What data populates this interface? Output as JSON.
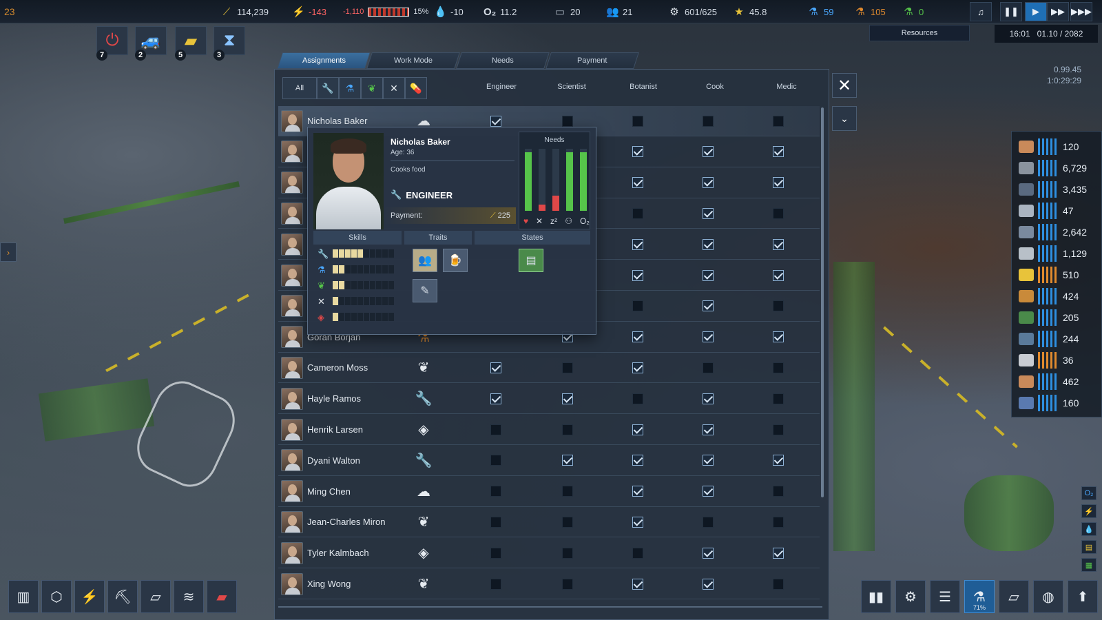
{
  "topbar": {
    "corner_number": "23",
    "money": "114,239",
    "energy": "-143",
    "energy_total": "-1,110",
    "battery_pct": "15%",
    "water": "-10",
    "oxygen": "11.2",
    "housing": "20",
    "colonists": "21",
    "storage": "601/625",
    "rating": "45.8",
    "research_blue": "59",
    "research_orange": "105",
    "research_green": "0"
  },
  "resources_button": "Resources",
  "date": {
    "time": "16:01",
    "date": "01.10 / 2082"
  },
  "version": {
    "v": "0.99.45",
    "clock": "1:0:29:29"
  },
  "status_buttons": [
    {
      "icon": "power-icon",
      "count": "7"
    },
    {
      "icon": "rover-icon",
      "count": "2"
    },
    {
      "icon": "gold-bars-icon",
      "count": "5"
    },
    {
      "icon": "hourglass-icon",
      "count": "3"
    }
  ],
  "tabs": [
    "Assignments",
    "Work Mode",
    "Needs",
    "Payment"
  ],
  "filter_all": "All",
  "columns": [
    "Engineer",
    "Scientist",
    "Botanist",
    "Cook",
    "Medic"
  ],
  "rows": [
    {
      "name": "Nicholas Baker",
      "role": "cook",
      "checks": [
        true,
        false,
        false,
        false,
        false
      ]
    },
    {
      "name": "",
      "role": "",
      "checks": [
        null,
        null,
        true,
        true,
        true
      ]
    },
    {
      "name": "",
      "role": "",
      "checks": [
        null,
        null,
        true,
        true,
        true
      ]
    },
    {
      "name": "",
      "role": "",
      "checks": [
        null,
        null,
        false,
        true,
        false
      ]
    },
    {
      "name": "",
      "role": "",
      "checks": [
        null,
        null,
        true,
        true,
        true
      ]
    },
    {
      "name": "",
      "role": "",
      "checks": [
        null,
        null,
        true,
        true,
        true
      ]
    },
    {
      "name": "",
      "role": "",
      "checks": [
        null,
        null,
        false,
        true,
        false
      ]
    },
    {
      "name": "Goran Borjan",
      "role": "scientist",
      "checks": [
        null,
        true,
        true,
        true,
        true
      ]
    },
    {
      "name": "Cameron Moss",
      "role": "botanist",
      "checks": [
        true,
        false,
        true,
        false,
        false
      ]
    },
    {
      "name": "Hayle Ramos",
      "role": "engineer",
      "checks": [
        true,
        true,
        false,
        true,
        false
      ]
    },
    {
      "name": "Henrik Larsen",
      "role": "medic",
      "checks": [
        false,
        false,
        true,
        true,
        false
      ]
    },
    {
      "name": "Dyani Walton",
      "role": "engineer",
      "checks": [
        false,
        true,
        true,
        true,
        true
      ]
    },
    {
      "name": "Ming Chen",
      "role": "cook",
      "checks": [
        false,
        false,
        true,
        true,
        false
      ]
    },
    {
      "name": "Jean-Charles Miron",
      "role": "botanist",
      "checks": [
        false,
        false,
        true,
        false,
        false
      ]
    },
    {
      "name": "Tyler Kalmbach",
      "role": "medic",
      "checks": [
        false,
        false,
        false,
        true,
        true
      ]
    },
    {
      "name": "Xing Wong",
      "role": "botanist",
      "checks": [
        false,
        false,
        true,
        true,
        false
      ]
    }
  ],
  "popup": {
    "name": "Nicholas Baker",
    "age": "Age: 36",
    "job": "Cooks food",
    "role": "ENGINEER",
    "payment_label": "Payment:",
    "payment": "225",
    "needs_label": "Needs",
    "needs": [
      {
        "name": "health",
        "level": 0.95,
        "color": "#56c44a"
      },
      {
        "name": "food",
        "level": 0.1,
        "color": "#e04848"
      },
      {
        "name": "sleep",
        "level": 0.25,
        "color": "#e04848"
      },
      {
        "name": "fun",
        "level": 0.95,
        "color": "#56c44a"
      },
      {
        "name": "oxygen",
        "level": 0.95,
        "color": "#56c44a"
      }
    ],
    "sections": [
      "Skills",
      "Traits",
      "States"
    ],
    "skills": [
      {
        "icon": "wrench-icon",
        "level": 5
      },
      {
        "icon": "flask-icon",
        "level": 2
      },
      {
        "icon": "plant-icon",
        "level": 2
      },
      {
        "icon": "utensils-icon",
        "level": 1
      },
      {
        "icon": "pill-icon",
        "level": 1
      }
    ]
  },
  "resources": [
    "120",
    "6,729",
    "3,435",
    "47",
    "2,642",
    "1,129",
    "510",
    "424",
    "205",
    "244",
    "36",
    "462",
    "160"
  ],
  "bottom_battery": "71%"
}
